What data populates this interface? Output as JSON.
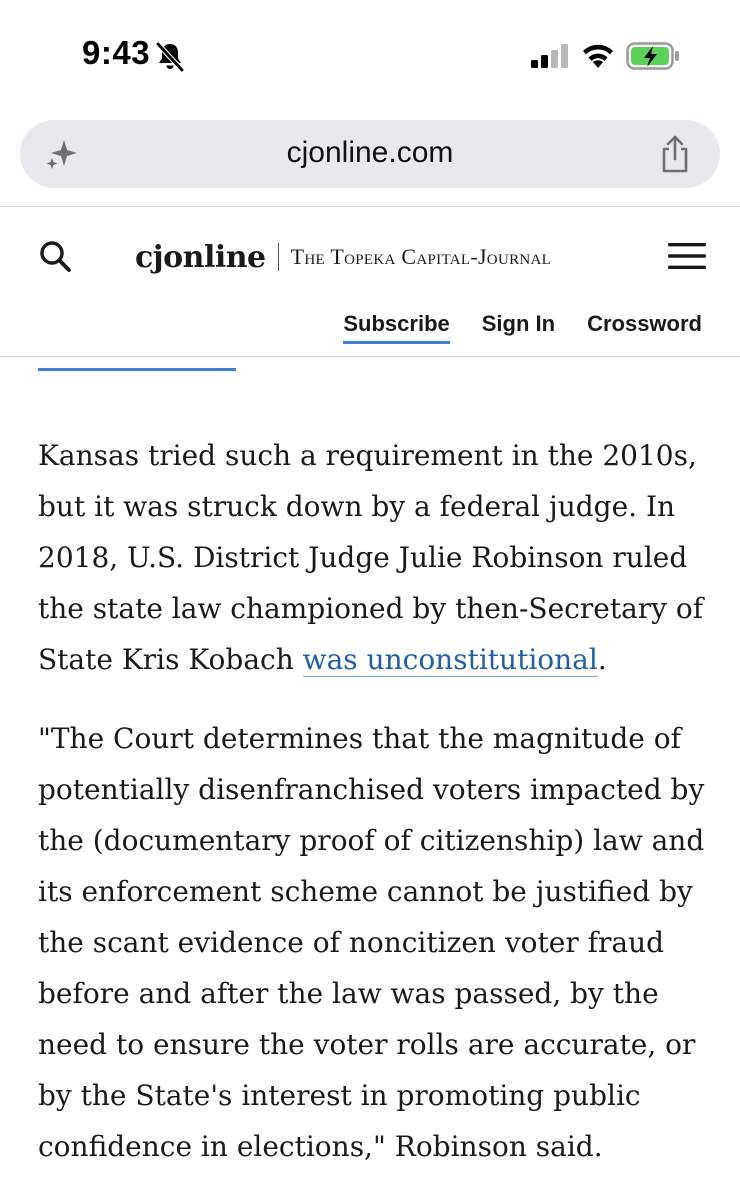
{
  "status_bar": {
    "time": "9:43",
    "icons": [
      "bell-slash-icon",
      "cellular-signal-icon",
      "wifi-icon",
      "battery-charging-icon"
    ]
  },
  "address_bar": {
    "url": "cjonline.com",
    "left_icon": "sparkle-icon",
    "right_icon": "share-icon"
  },
  "site": {
    "logo_short": "cjonline",
    "logo_paper": "The Topeka Capital-Journal",
    "nav": {
      "subscribe": "Subscribe",
      "sign_in": "Sign In",
      "crossword": "Crossword"
    }
  },
  "colors": {
    "accent": "#3b7fd6",
    "link": "#1f5fa8"
  },
  "article": {
    "p1_text": "Kansas tried such a requirement in the 2010s, but it was struck down by a federal judge. In 2018, U.S. District Judge Julie Robinson ruled the state law championed by then-Secretary of State Kris Kobach ",
    "p1_link": "was unconstitutional",
    "p1_end": ".",
    "p2_text": "\"The Court determines that the magnitude of potentially disenfranchised voters impacted by the (documentary proof of citizenship) law and its enforcement scheme cannot be justified by the scant evidence of noncitizen voter fraud before and after the law was passed, by the need to ensure the voter rolls are accurate, or by the State's interest in promoting public confidence in elections,\" Robinson said."
  }
}
